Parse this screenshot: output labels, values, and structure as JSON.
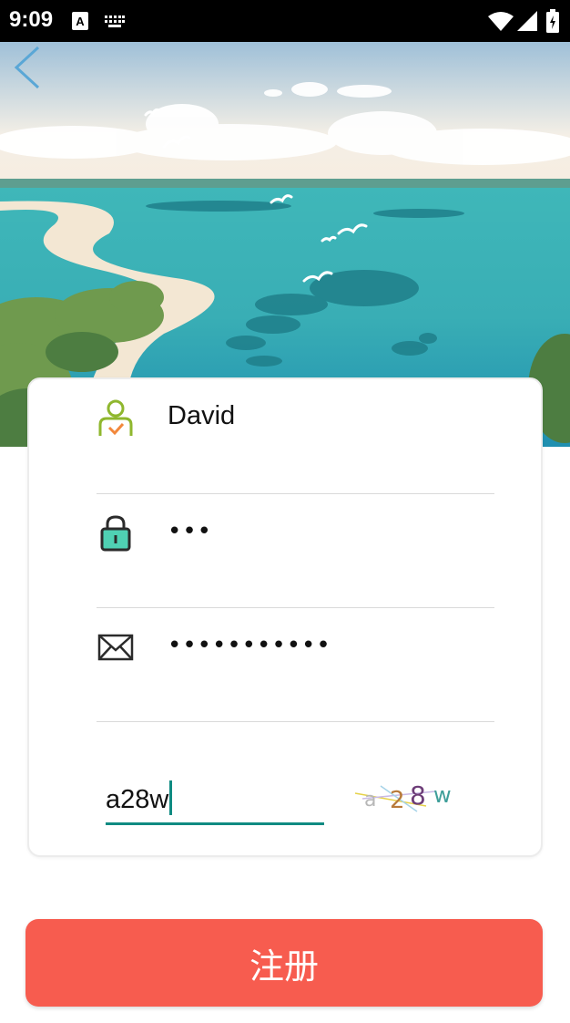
{
  "status_bar": {
    "time": "9:09"
  },
  "form": {
    "username": "David",
    "password_mask": "•••",
    "email_mask": "•••••••••••",
    "captcha_input": "a28w",
    "captcha_chars": [
      "a",
      "2",
      "8",
      "w"
    ]
  },
  "register_button": "注册",
  "colors": {
    "accent": "#0f8b82",
    "button": "#f75c4f"
  }
}
